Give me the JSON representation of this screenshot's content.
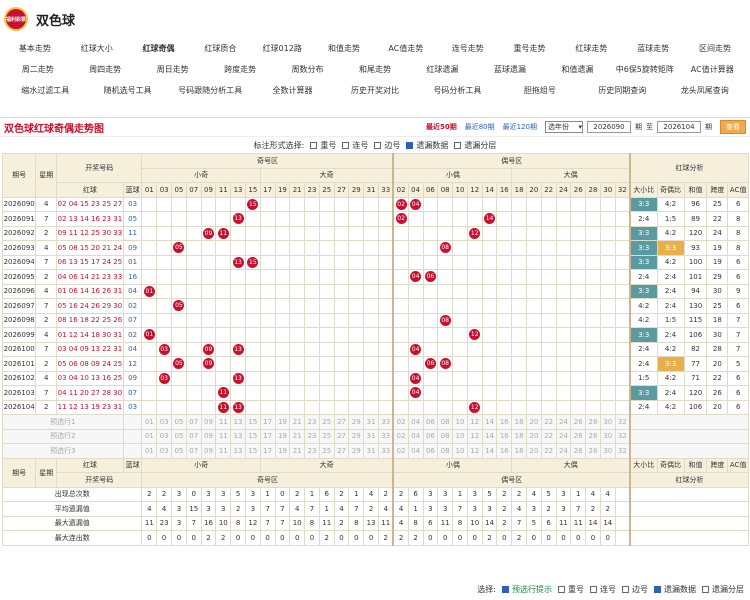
{
  "app": {
    "title": "双色球",
    "logo_text": "福利彩票"
  },
  "nav": [
    [
      "基本走势",
      "红球大小",
      "红球奇偶",
      "红球质合",
      "红球012路",
      "和值走势",
      "AC值走势",
      "连号走势",
      "重号走势",
      "红球走势",
      "蓝球走势",
      "区间走势"
    ],
    [
      "周二走势",
      "周四走势",
      "周日走势",
      "跨度走势",
      "周数分布",
      "和尾走势",
      "红球遗漏",
      "蓝球遗漏",
      "和值遗漏",
      "中6保5旋转矩阵",
      "AC值计算器"
    ],
    [
      "缩水过滤工具",
      "随机选号工具",
      "号码跟随分析工具",
      "全数计算器",
      "历史开奖对比",
      "号码分析工具",
      "胆拖组号",
      "历史同期查询",
      "龙头凤尾查询"
    ]
  ],
  "active_nav": "红球奇偶",
  "page": {
    "title": "双色球红球奇偶走势图",
    "recent": [
      "最近50期",
      "最近80期",
      "最近120期"
    ],
    "select": "选年份",
    "from": "2026090",
    "to": "2026104",
    "qi": "期",
    "zhi": "至",
    "query": "查看"
  },
  "filter": {
    "label": "标注形式选择:",
    "opts": [
      {
        "t": "重号",
        "c": false
      },
      {
        "t": "连号",
        "c": false
      },
      {
        "t": "边号",
        "c": false
      },
      {
        "t": "遗漏数据",
        "c": true
      },
      {
        "t": "遗漏分层",
        "c": false
      }
    ]
  },
  "headers": {
    "period": "期号",
    "week": "星期",
    "open": "开奖号码",
    "red": "红球",
    "blue": "蓝球",
    "qiqu": "奇号区",
    "ouqu": "偶号区",
    "xiaoqi": "小奇",
    "daqi": "大奇",
    "xiaoou": "小偶",
    "daou": "大偶",
    "analysis": "红球分析",
    "cols": [
      "大小比",
      "奇偶比",
      "和值",
      "跨度",
      "AC值"
    ]
  },
  "odd": [
    "01",
    "03",
    "05",
    "07",
    "09",
    "11",
    "13",
    "15",
    "17",
    "19",
    "21",
    "23",
    "25",
    "27",
    "29",
    "31",
    "33"
  ],
  "even": [
    "02",
    "04",
    "06",
    "08",
    "10",
    "12",
    "14",
    "16",
    "18",
    "20",
    "22",
    "24",
    "26",
    "28",
    "30",
    "32"
  ],
  "rows": [
    {
      "p": "2026090",
      "w": "4",
      "r": "02 04 15 23 25 27",
      "b": "03",
      "oh": [
        7
      ],
      "eh": [
        0,
        1
      ],
      "a": [
        "3:3",
        "4:2",
        "96",
        "25",
        "6"
      ]
    },
    {
      "p": "2026091",
      "w": "7",
      "r": "02 13 14 16 23 31",
      "b": "05",
      "oh": [
        6
      ],
      "eh": [
        0,
        6
      ],
      "a": [
        "2:4",
        "1:5",
        "89",
        "22",
        "8"
      ]
    },
    {
      "p": "2026092",
      "w": "2",
      "r": "09 11 12 25 30 33",
      "b": "11",
      "oh": [
        4,
        5
      ],
      "eh": [
        5
      ],
      "a": [
        "3:3",
        "4:2",
        "120",
        "24",
        "8"
      ]
    },
    {
      "p": "2026093",
      "w": "4",
      "r": "05 08 15 20 21 24",
      "b": "09",
      "oh": [
        2
      ],
      "eh": [
        3
      ],
      "a": [
        "3:3",
        "3:3",
        "93",
        "19",
        "8"
      ]
    },
    {
      "p": "2026094",
      "w": "7",
      "r": "06 13 15 17 24 25",
      "b": "01",
      "oh": [
        6,
        7
      ],
      "eh": [],
      "a": [
        "3:3",
        "4:2",
        "100",
        "19",
        "6"
      ]
    },
    {
      "p": "2026095",
      "w": "2",
      "r": "04 06 14 21 23 33",
      "b": "16",
      "oh": [],
      "eh": [
        1,
        2
      ],
      "a": [
        "2:4",
        "2:4",
        "101",
        "29",
        "6"
      ]
    },
    {
      "p": "2026096",
      "w": "4",
      "r": "01 06 14 16 26 31",
      "b": "04",
      "oh": [
        0
      ],
      "eh": [],
      "a": [
        "3:3",
        "2:4",
        "94",
        "30",
        "9"
      ]
    },
    {
      "p": "2026097",
      "w": "7",
      "r": "05 16 24 26 29 30",
      "b": "02",
      "oh": [
        2
      ],
      "eh": [],
      "a": [
        "4:2",
        "2:4",
        "130",
        "25",
        "6"
      ]
    },
    {
      "p": "2026098",
      "w": "2",
      "r": "08 16 18 22 25 26",
      "b": "07",
      "oh": [],
      "eh": [
        3
      ],
      "a": [
        "4:2",
        "1:5",
        "115",
        "18",
        "7"
      ]
    },
    {
      "p": "2026099",
      "w": "4",
      "r": "01 12 14 18 30 31",
      "b": "02",
      "oh": [
        0
      ],
      "eh": [
        5
      ],
      "a": [
        "3:3",
        "2:4",
        "106",
        "30",
        "7"
      ]
    },
    {
      "p": "2026100",
      "w": "7",
      "r": "03 04 09 13 22 31",
      "b": "04",
      "oh": [
        1,
        4,
        6
      ],
      "eh": [
        1
      ],
      "a": [
        "2:4",
        "4:2",
        "82",
        "28",
        "7"
      ]
    },
    {
      "p": "2026101",
      "w": "2",
      "r": "05 06 08 09 24 25",
      "b": "12",
      "oh": [
        2,
        4
      ],
      "eh": [
        2,
        3
      ],
      "a": [
        "2:4",
        "3:3",
        "77",
        "20",
        "5"
      ]
    },
    {
      "p": "2026102",
      "w": "4",
      "r": "03 04 10 13 16 25",
      "b": "09",
      "oh": [
        1,
        6
      ],
      "eh": [
        1
      ],
      "a": [
        "1:5",
        "4:2",
        "71",
        "22",
        "6"
      ]
    },
    {
      "p": "2026103",
      "w": "7",
      "r": "04 11 20 27 28 30",
      "b": "07",
      "oh": [
        5
      ],
      "eh": [
        1
      ],
      "a": [
        "3:3",
        "2:4",
        "120",
        "26",
        "6"
      ]
    },
    {
      "p": "2026104",
      "w": "2",
      "r": "11 12 13 19 23 31",
      "b": "03",
      "oh": [
        5,
        6
      ],
      "eh": [
        5
      ],
      "a": [
        "2:4",
        "4:2",
        "106",
        "20",
        "6"
      ]
    }
  ],
  "presel": [
    "预选行1",
    "预选行2",
    "预选行3"
  ],
  "stats": [
    {
      "l": "出现总次数",
      "v": "2 2 3 0 3 3 5 3 1 0 2 1 6 2 1 4 2 2 6 3 3 1 3 5 2 2 4 5 3 1 4 4"
    },
    {
      "l": "平均遗漏值",
      "v": "4 4 3 15 3 3 2 3 7 7 4 7 1 4 7 2 4 4 1 3 3 7 3 3 2 4 3 2 3 7 2 2"
    },
    {
      "l": "最大遗漏值",
      "v": "11 23 3 7 16 10 8 12 7 7 10 8 11 2 8 13 11 4 8 6 11 8 10 14 2 7 5 6 11 11 14 14"
    },
    {
      "l": "最大连出数",
      "v": "0 0 0 0 2 2 0 0 0 0 0 0 2 0 0 0 2 2 2 0 0 0 0 2 0 2 0 0 0 0 0 0"
    }
  ],
  "stats_head": {
    "p": "期号",
    "w": "星期",
    "kj": "开奖号码",
    "red": "红球",
    "blue": "蓝球"
  },
  "foot": {
    "label": "选择:",
    "opts": [
      {
        "t": "预选行提示",
        "c": true,
        "g": true
      },
      {
        "t": "重号",
        "c": false
      },
      {
        "t": "连号",
        "c": false
      },
      {
        "t": "边号",
        "c": false
      },
      {
        "t": "遗漏数据",
        "c": true
      },
      {
        "t": "遗漏分层",
        "c": false
      }
    ]
  }
}
